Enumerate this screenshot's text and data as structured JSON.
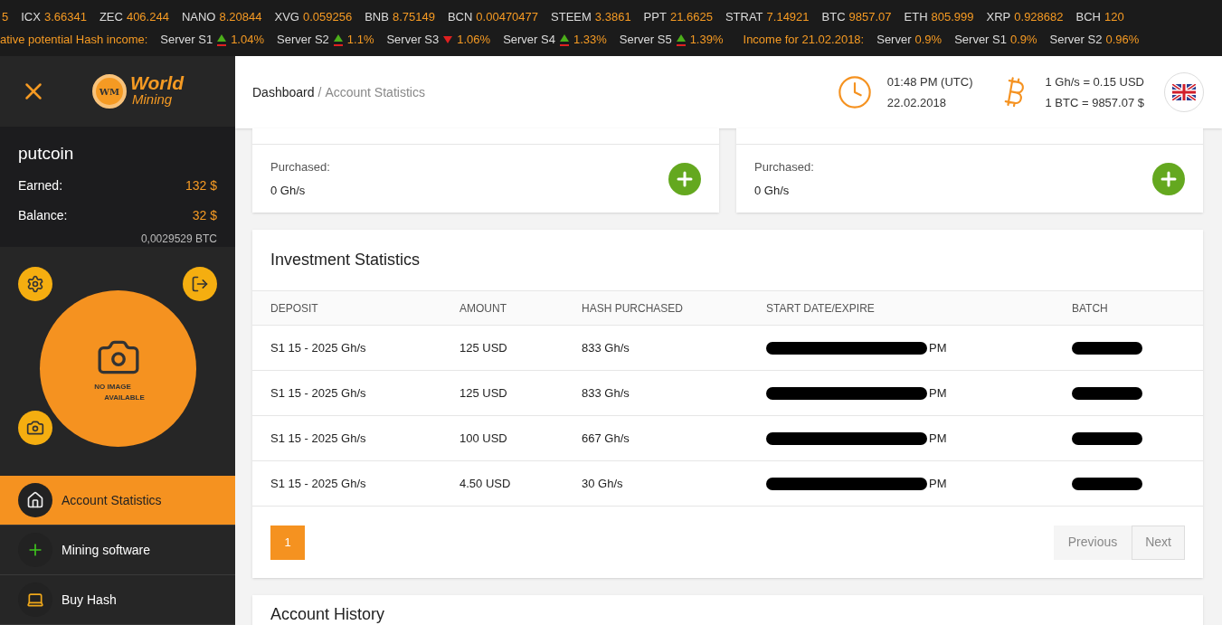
{
  "ticker": [
    {
      "value": "5"
    },
    {
      "symbol": "ICX",
      "value": "3.66341"
    },
    {
      "symbol": "ZEC",
      "value": "406.244"
    },
    {
      "symbol": "NANO",
      "value": "8.20844"
    },
    {
      "symbol": "XVG",
      "value": "0.059256"
    },
    {
      "symbol": "BNB",
      "value": "8.75149"
    },
    {
      "symbol": "BCN",
      "value": "0.00470477"
    },
    {
      "symbol": "STEEM",
      "value": "3.3861"
    },
    {
      "symbol": "PPT",
      "value": "21.6625"
    },
    {
      "symbol": "STRAT",
      "value": "7.14921"
    },
    {
      "symbol": "BTC",
      "value": "9857.07"
    },
    {
      "symbol": "ETH",
      "value": "805.999"
    },
    {
      "symbol": "XRP",
      "value": "0.928682"
    },
    {
      "symbol": "BCH",
      "value": "120"
    }
  ],
  "income_bar": {
    "potential_label": "ative potential Hash income:",
    "potential": [
      {
        "server": "Server S1",
        "rising": true,
        "value": "1.04%"
      },
      {
        "server": "Server S2",
        "rising": true,
        "value": "1.1%"
      },
      {
        "server": "Server S3",
        "rising": false,
        "value": "1.06%"
      },
      {
        "server": "Server S4",
        "rising": true,
        "value": "1.33%"
      },
      {
        "server": "Server S5",
        "rising": true,
        "value": "1.39%"
      }
    ],
    "income_label": "Income for 21.02.2018:",
    "income": [
      {
        "server": "Server",
        "value": "0.9%"
      },
      {
        "server": "Server S1",
        "value": "0.9%"
      },
      {
        "server": "Server S2",
        "value": "0.96%"
      }
    ]
  },
  "logo": {
    "badge": "WM",
    "line1": "World",
    "line2": "Mining"
  },
  "user": {
    "name": "putcoin",
    "earned_label": "Earned:",
    "earned": "132 $",
    "balance_label": "Balance:",
    "balance": "32 $",
    "balance_btc": "0,0029529 BTC"
  },
  "avatar": {
    "line1": "NO IMAGE",
    "line2": "AVAILABLE"
  },
  "nav": [
    {
      "label": "Account Statistics",
      "kind": "home",
      "selected": true
    },
    {
      "label": "Mining software",
      "kind": "software",
      "selected": false
    },
    {
      "label": "Buy Hash",
      "kind": "buy",
      "selected": false
    }
  ],
  "breadcrumb": {
    "root": "Dashboard",
    "separator": "/",
    "current": "Account Statistics"
  },
  "clock": {
    "time": "01:48 PM (UTC)",
    "date": "22.02.2018"
  },
  "rates": {
    "hash": "1 Gh/s = 0.15 USD",
    "btc": "1 BTC = 9857.07 $"
  },
  "purchase_cards": [
    {
      "label": "Purchased:",
      "value": "0 Gh/s"
    },
    {
      "label": "Purchased:",
      "value": "0 Gh/s"
    }
  ],
  "investment": {
    "title": "Investment Statistics",
    "columns": [
      "DEPOSIT",
      "AMOUNT",
      "HASH PURCHASED",
      "START DATE/EXPIRE",
      "BATCH"
    ],
    "rows": [
      {
        "deposit": "S1 15 - 2025 Gh/s",
        "amount": "125 USD",
        "hash": "833 Gh/s",
        "start": "PM"
      },
      {
        "deposit": "S1 15 - 2025 Gh/s",
        "amount": "125 USD",
        "hash": "833 Gh/s",
        "start": "PM"
      },
      {
        "deposit": "S1 15 - 2025 Gh/s",
        "amount": "100 USD",
        "hash": "667 Gh/s",
        "start": "PM"
      },
      {
        "deposit": "S1 15 - 2025 Gh/s",
        "amount": "4.50 USD",
        "hash": "30 Gh/s",
        "start": "PM"
      }
    ],
    "pages": [
      {
        "label": "1",
        "selected": true
      }
    ],
    "previous": "Previous",
    "next": "Next"
  },
  "history": {
    "title": "Account History"
  }
}
